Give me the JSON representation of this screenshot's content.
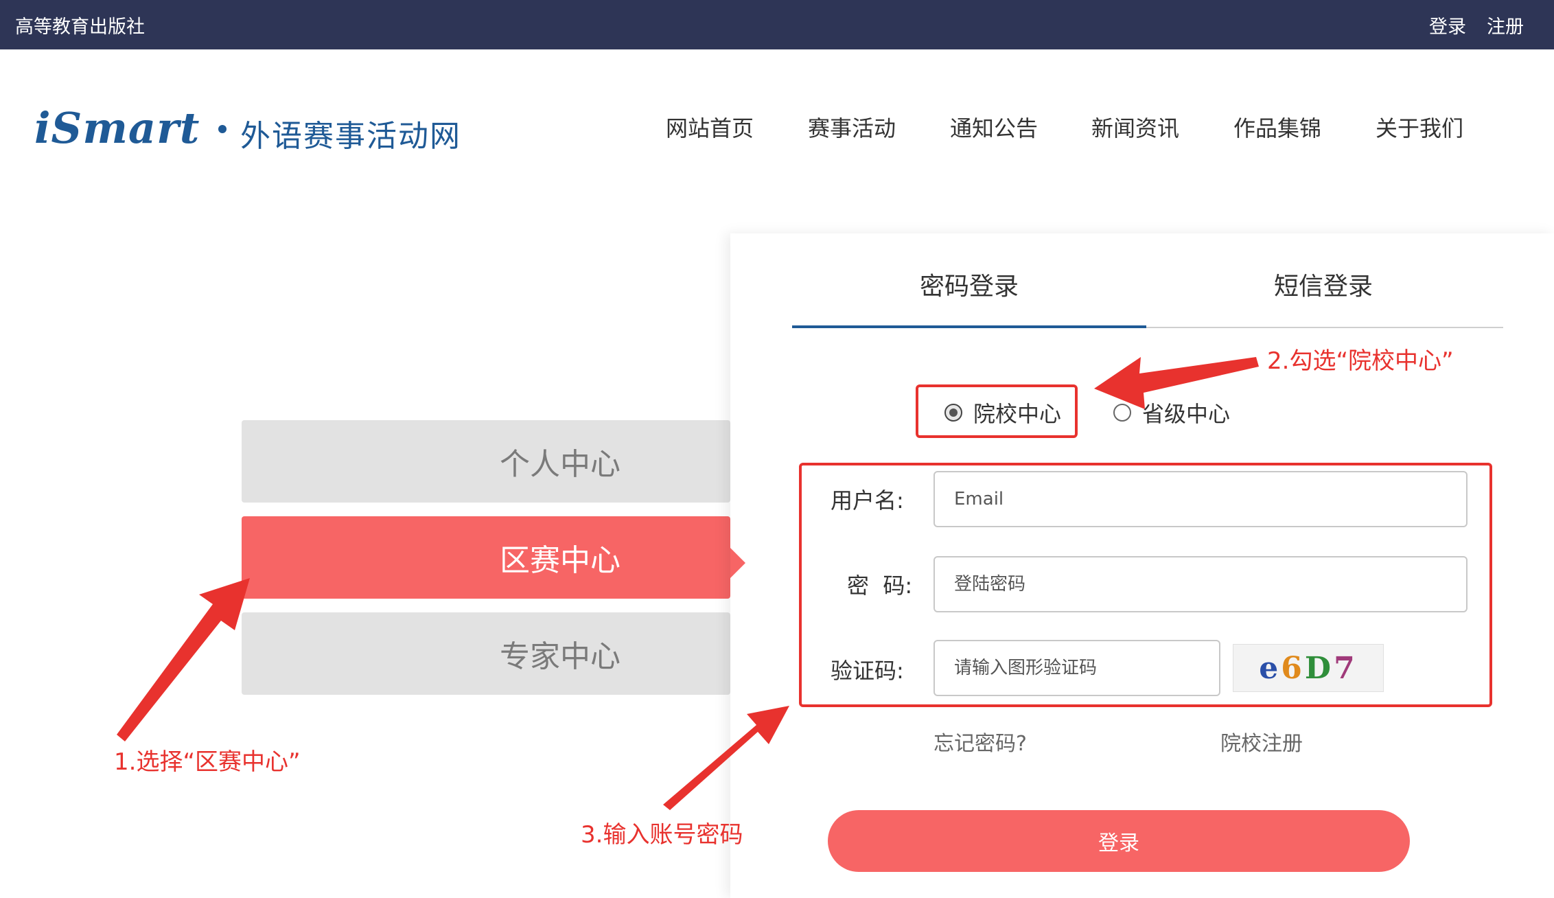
{
  "topbar": {
    "publisher": "高等教育出版社",
    "login": "登录",
    "register": "注册"
  },
  "header": {
    "logo_text": "iSmart",
    "logo_cn": "外语赛事活动网",
    "nav": [
      "网站首页",
      "赛事活动",
      "通知公告",
      "新闻资讯",
      "作品集锦",
      "关于我们"
    ]
  },
  "roles": [
    {
      "label": "个人中心",
      "active": false
    },
    {
      "label": "区赛中心",
      "active": true
    },
    {
      "label": "专家中心",
      "active": false
    }
  ],
  "login": {
    "tabs": [
      {
        "label": "密码登录",
        "active": true
      },
      {
        "label": "短信登录",
        "active": false
      }
    ],
    "radios": [
      {
        "label": "院校中心",
        "checked": true
      },
      {
        "label": "省级中心",
        "checked": false
      }
    ],
    "username": {
      "label": "用户名:",
      "placeholder": "Email"
    },
    "password": {
      "label": "密  码:",
      "placeholder": "登陆密码"
    },
    "captcha": {
      "label": "验证码:",
      "placeholder": "请输入图形验证码",
      "code": [
        "e",
        "6",
        "D",
        "7"
      ]
    },
    "forgot": "忘记密码?",
    "school_register": "院校注册",
    "submit": "登录"
  },
  "annotations": {
    "step1": "1.选择“区赛中心”",
    "step2": "2.勾选“院校中心”",
    "step3": "3.输入账号密码",
    "color": "#e8322e"
  },
  "colors": {
    "topbar": "#2e3556",
    "brand": "#1f5a96",
    "accent": "#f76565"
  }
}
